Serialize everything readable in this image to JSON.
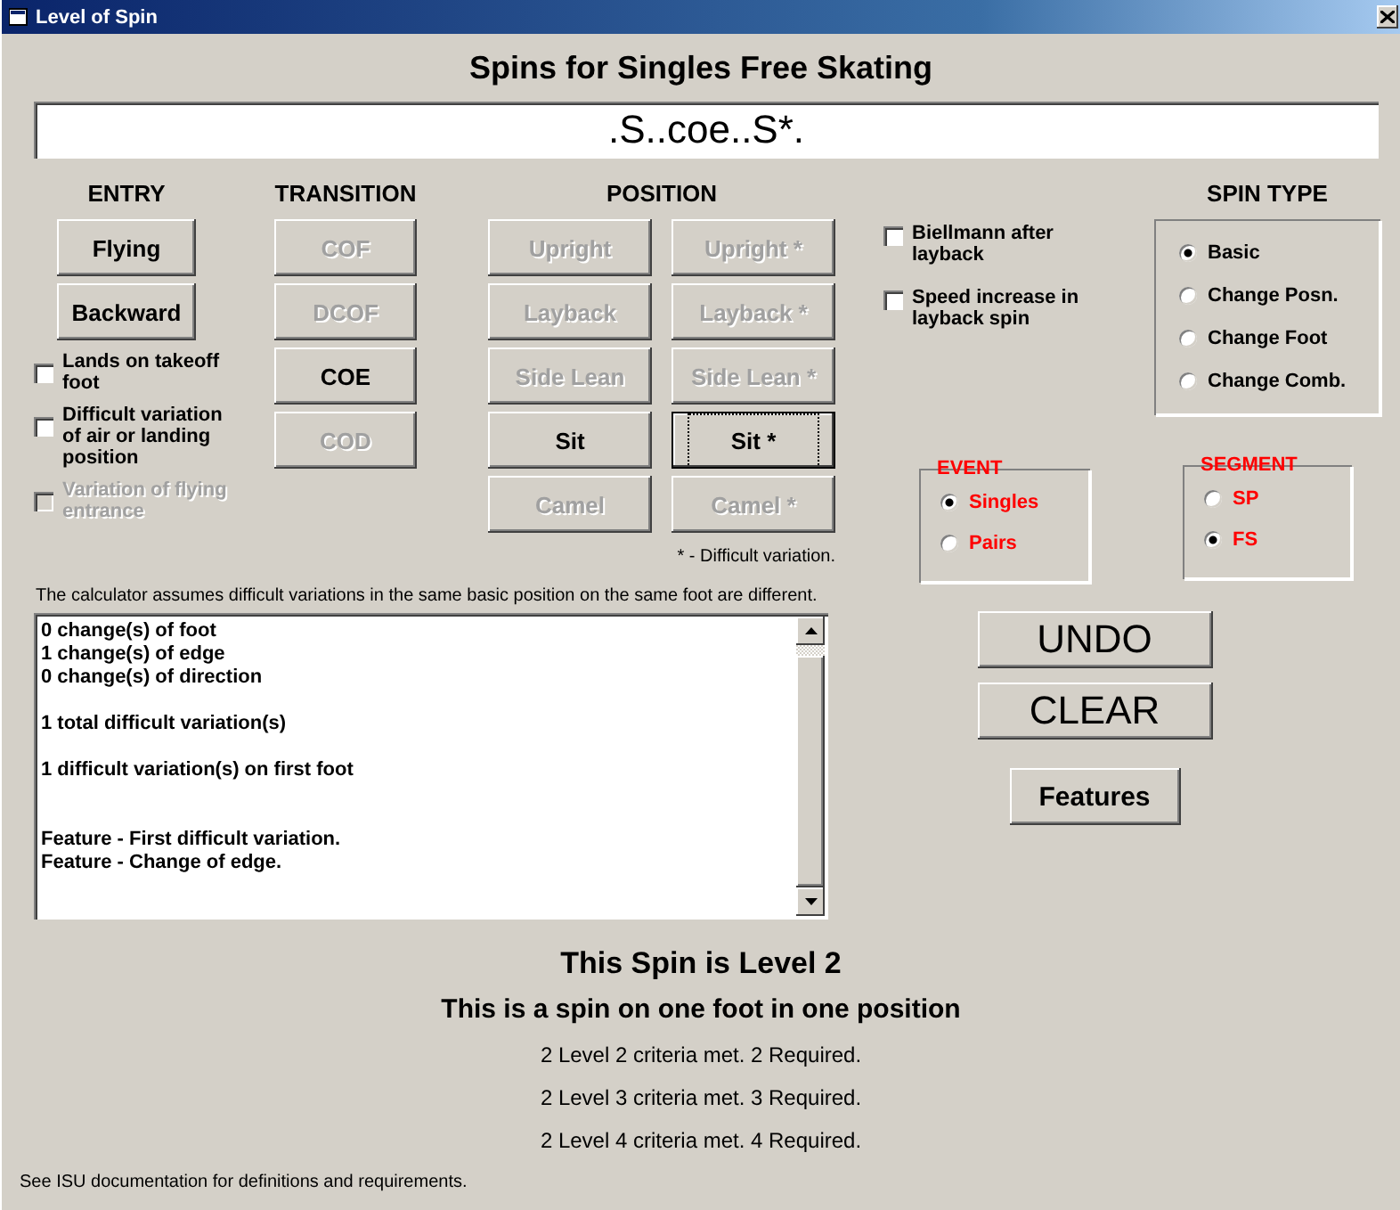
{
  "window": {
    "title": "Level of Spin"
  },
  "heading": "Spins for Singles Free Skating",
  "code": ".S..coe..S*.",
  "entry": {
    "label": "ENTRY",
    "buttons": [
      {
        "label": "Flying",
        "disabled": false
      },
      {
        "label": "Backward",
        "disabled": false
      }
    ],
    "checkboxes": [
      {
        "label": "Lands on takeoff foot",
        "checked": false,
        "disabled": false
      },
      {
        "label": "Difficult variation of air or landing position",
        "checked": false,
        "disabled": false
      },
      {
        "label": "Variation of flying entrance",
        "checked": false,
        "disabled": true
      }
    ]
  },
  "transition": {
    "label": "TRANSITION",
    "buttons": [
      {
        "label": "COF",
        "disabled": true
      },
      {
        "label": "DCOF",
        "disabled": true
      },
      {
        "label": "COE",
        "disabled": false
      },
      {
        "label": "COD",
        "disabled": true
      }
    ]
  },
  "position": {
    "label": "POSITION",
    "buttons": [
      {
        "label": "Upright",
        "disabled": true,
        "focused": false
      },
      {
        "label": "Upright *",
        "disabled": true,
        "focused": false
      },
      {
        "label": "Layback",
        "disabled": true,
        "focused": false
      },
      {
        "label": "Layback *",
        "disabled": true,
        "focused": false
      },
      {
        "label": "Side Lean",
        "disabled": true,
        "focused": false
      },
      {
        "label": "Side Lean *",
        "disabled": true,
        "focused": false
      },
      {
        "label": "Sit",
        "disabled": false,
        "focused": false
      },
      {
        "label": "Sit *",
        "disabled": false,
        "focused": true
      },
      {
        "label": "Camel",
        "disabled": true,
        "focused": false
      },
      {
        "label": "Camel *",
        "disabled": true,
        "focused": false
      }
    ],
    "footnote": "* - Difficult variation."
  },
  "layback_options": [
    {
      "label": "Biellmann after layback",
      "checked": false
    },
    {
      "label": "Speed increase in layback spin",
      "checked": false
    }
  ],
  "spin_type": {
    "label": "SPIN TYPE",
    "options": [
      {
        "label": "Basic",
        "selected": true
      },
      {
        "label": "Change Posn.",
        "selected": false
      },
      {
        "label": "Change Foot",
        "selected": false
      },
      {
        "label": "Change Comb.",
        "selected": false
      }
    ]
  },
  "event": {
    "label": "EVENT",
    "options": [
      {
        "label": "Singles",
        "selected": true
      },
      {
        "label": "Pairs",
        "selected": false
      }
    ]
  },
  "segment": {
    "label": "SEGMENT",
    "options": [
      {
        "label": "SP",
        "selected": false
      },
      {
        "label": "FS",
        "selected": true
      }
    ]
  },
  "note": "The calculator assumes difficult variations in the same basic position on the same foot are different.",
  "results": "0 change(s) of foot\n1 change(s) of edge\n0 change(s) of direction\n\n1 total difficult variation(s)\n\n1 difficult variation(s) on first foot\n\n\nFeature - First difficult variation.\nFeature - Change of edge.",
  "actions": [
    {
      "label": "UNDO",
      "kind": "large"
    },
    {
      "label": "CLEAR",
      "kind": "large"
    },
    {
      "label": "Features",
      "kind": "small"
    }
  ],
  "summary": {
    "headline": "This Spin is Level 2",
    "description": "This is a spin on one foot in one position",
    "criteria": [
      "2 Level 2 criteria met.  2 Required.",
      "2 Level 3 criteria met.  3 Required.",
      "2 Level 4 criteria met.  4 Required."
    ],
    "footer": "See ISU documentation for definitions and requirements."
  }
}
